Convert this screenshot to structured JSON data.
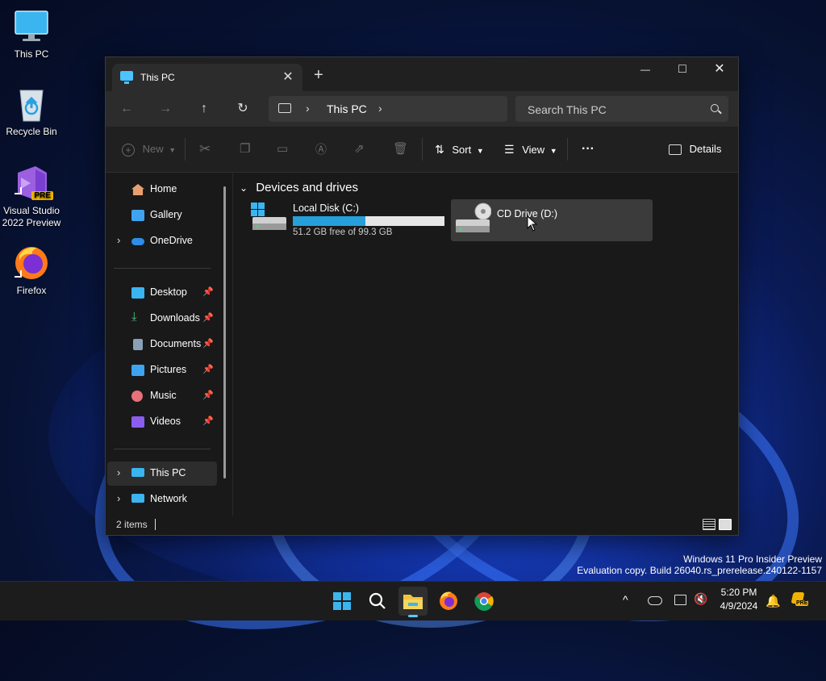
{
  "desktop": {
    "icons": [
      {
        "label": "This PC"
      },
      {
        "label": "Recycle Bin"
      },
      {
        "label": "Visual Studio 2022 Preview",
        "badge": "PRE"
      },
      {
        "label": "Firefox"
      }
    ],
    "watermark_line1": "Windows 11 Pro Insider Preview",
    "watermark_line2": "Evaluation copy. Build 26040.rs_prerelease.240122-1157"
  },
  "window": {
    "tab_title": "This PC",
    "tab_close": "✕",
    "new_tab": "+",
    "minimize": "—",
    "maximize": "□",
    "close": "✕"
  },
  "navigation": {
    "back": "←",
    "forward": "→",
    "up": "↑",
    "refresh": "↻",
    "breadcrumb": "This PC",
    "sep": "›",
    "search_placeholder": "Search This PC"
  },
  "toolbar": {
    "new_label": "New",
    "sort_label": "Sort",
    "view_label": "View",
    "more_label": "···",
    "details_label": "Details"
  },
  "sidebar": {
    "items": [
      {
        "label": "Home"
      },
      {
        "label": "Gallery"
      },
      {
        "label": "OneDrive"
      },
      {
        "label": "Desktop"
      },
      {
        "label": "Downloads"
      },
      {
        "label": "Documents"
      },
      {
        "label": "Pictures"
      },
      {
        "label": "Music"
      },
      {
        "label": "Videos"
      },
      {
        "label": "This PC"
      },
      {
        "label": "Network"
      }
    ],
    "pin_glyph": "📌",
    "chevron": "›"
  },
  "content": {
    "group_title": "Devices and drives",
    "group_chevron": "⌄",
    "drives": [
      {
        "name": "Local Disk (C:)",
        "free_text": "51.2 GB free of 99.3 GB",
        "used_fraction": 0.48
      },
      {
        "name": "CD Drive (D:)"
      }
    ]
  },
  "status": {
    "item_count": "2 items"
  },
  "taskbar": {
    "time": "5:20 PM",
    "date": "4/9/2024",
    "tray_chevron": "^",
    "badge": "PRE"
  },
  "colors": {
    "accent": "#26a0da",
    "window_bg": "#191919"
  }
}
